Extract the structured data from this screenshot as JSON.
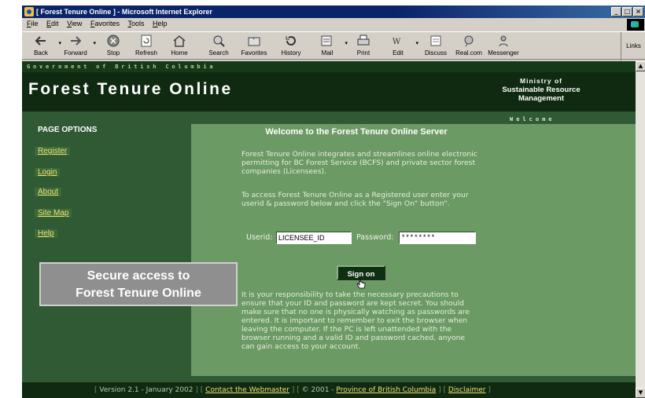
{
  "window": {
    "title": "[ Forest Tenure Online ] - Microsoft Internet Explorer",
    "controls": [
      "_",
      "□",
      "×"
    ]
  },
  "menu": [
    "File",
    "Edit",
    "View",
    "Favorites",
    "Tools",
    "Help"
  ],
  "toolbar": {
    "buttons": [
      "Back",
      "Forward",
      "Stop",
      "Refresh",
      "Home",
      "Search",
      "Favorites",
      "History",
      "Mail",
      "Print",
      "Edit",
      "Discuss",
      "Real.com",
      "Messenger"
    ],
    "links_label": "Links"
  },
  "site": {
    "gov_strip": "Government of British Columbia",
    "title": "Forest Tenure Online",
    "ministry": [
      "Ministry of",
      "Sustainable Resource",
      "Management"
    ],
    "welcome_tag": "Welcome"
  },
  "nav": {
    "heading": "PAGE OPTIONS",
    "items": [
      "Register",
      "Login",
      "About",
      "Site Map",
      "Help"
    ]
  },
  "main": {
    "title": "Welcome to the Forest Tenure Online Server",
    "intro": "Forest Tenure Online integrates and streamlines online electronic permitting for BC Forest Service (BCFS) and private sector forest companies (Licensees).",
    "instructions": "To access Forest Tenure Online as a Registered user enter your userid & password below and click the \"Sign On\" button\".",
    "userid_label": "Userid:",
    "userid_value": "LICENSEE_ID",
    "password_label": "Password:",
    "password_value": "********",
    "signon_label": "Sign on",
    "notice": "It is your responsibility to take the necessary precautions to ensure that your ID and password are kept secret. You should make sure that no one is physically watching as passwords are entered. It is important to remember to exit the browser when leaving the computer. If the PC is left unattended with the browser running and a valid ID and password cached, anyone can gain access to your account."
  },
  "callout": {
    "line1": "Secure access to",
    "line2": "Forest Tenure Online"
  },
  "footer": {
    "version": "Version 2.1 - January 2002",
    "contact": "Contact the Webmaster",
    "copyright_prefix": "© 2001 -",
    "province": "Province of British Columbia",
    "disclaimer": "Disclaimer"
  },
  "colors": {
    "page_bg": "#2f5a33",
    "panel_bg": "#6c9a64",
    "header_bg": "#0f2a11",
    "link": "#f3df7a"
  }
}
